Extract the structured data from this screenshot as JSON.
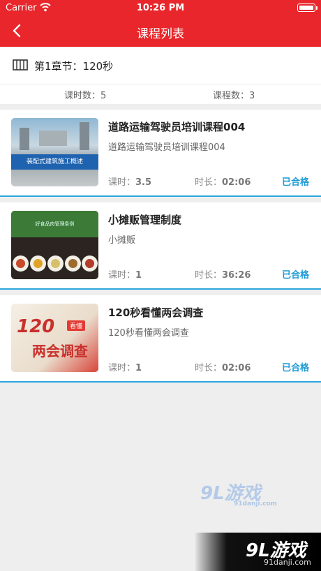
{
  "status_bar": {
    "carrier": "Carrier",
    "time": "10:26 PM"
  },
  "nav": {
    "title": "课程列表",
    "back_icon": "chevron-left-icon"
  },
  "chapter": {
    "title": "第1章节：120秒",
    "hours_label": "课时数：5",
    "courses_label": "课程数：3",
    "icon": "book-icon"
  },
  "courses": [
    {
      "title": "道路运输驾驶员培训课程004",
      "subtitle": "道路运输驾驶员培训课程004",
      "hours_label": "课时：",
      "hours": "3.5",
      "duration_label": "时长：",
      "duration": "02:06",
      "status": "已合格",
      "thumb_text": "装配式建筑施工概述"
    },
    {
      "title": "小摊贩管理制度",
      "subtitle": "小摊贩",
      "hours_label": "课时：",
      "hours": "1",
      "duration_label": "时长：",
      "duration": "36:26",
      "status": "已合格",
      "thumb_text": "好食品肉管理条例"
    },
    {
      "title": "120秒看懂两会调查",
      "subtitle": "120秒看懂两会调查",
      "hours_label": "课时：",
      "hours": "1",
      "duration_label": "时长：",
      "duration": "02:06",
      "status": "已合格",
      "thumb_big": "120",
      "thumb_script": "两会调查",
      "thumb_tag": "看懂"
    }
  ],
  "watermark": {
    "text": "9L游戏",
    "sub": "91danji.com"
  },
  "logo": {
    "text": "9L游戏",
    "url": "91danji.com"
  },
  "colors": {
    "brand_red": "#e8262b",
    "accent_blue": "#1a9ad6"
  }
}
